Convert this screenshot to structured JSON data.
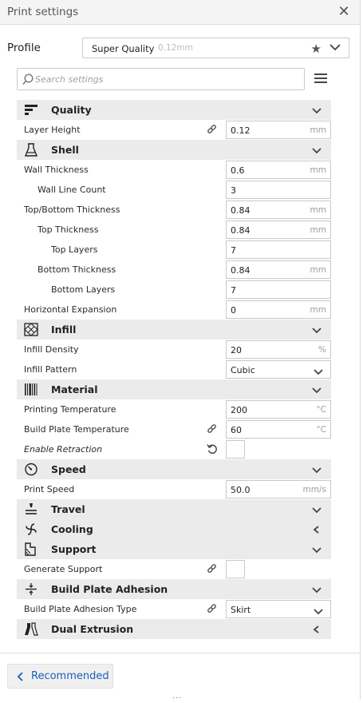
{
  "window": {
    "title": "Print settings",
    "close_icon": "close-icon"
  },
  "profile": {
    "label": "Profile",
    "selected": "Super Quality",
    "subtitle": "0.12mm"
  },
  "search": {
    "placeholder": "Search settings",
    "value": ""
  },
  "categories": {
    "quality": {
      "label": "Quality",
      "icon": "quality-icon",
      "expanded": true
    },
    "shell": {
      "label": "Shell",
      "icon": "shell-icon",
      "expanded": true
    },
    "infill": {
      "label": "Infill",
      "icon": "infill-icon",
      "expanded": true
    },
    "material": {
      "label": "Material",
      "icon": "material-icon",
      "expanded": true
    },
    "speed": {
      "label": "Speed",
      "icon": "speed-icon",
      "expanded": true
    },
    "travel": {
      "label": "Travel",
      "icon": "travel-icon",
      "expanded": true
    },
    "cooling": {
      "label": "Cooling",
      "icon": "cooling-icon",
      "expanded": false
    },
    "support": {
      "label": "Support",
      "icon": "support-icon",
      "expanded": true
    },
    "adhesion": {
      "label": "Build Plate Adhesion",
      "icon": "adhesion-icon",
      "expanded": true
    },
    "dual": {
      "label": "Dual Extrusion",
      "icon": "dual-extrusion-icon",
      "expanded": false
    }
  },
  "settings": {
    "layer_height": {
      "label": "Layer Height",
      "value": "0.12",
      "unit": "mm"
    },
    "wall_thickness": {
      "label": "Wall Thickness",
      "value": "0.6",
      "unit": "mm"
    },
    "wall_line_count": {
      "label": "Wall Line Count",
      "value": "3"
    },
    "top_bottom_thickness": {
      "label": "Top/Bottom Thickness",
      "value": "0.84",
      "unit": "mm"
    },
    "top_thickness": {
      "label": "Top Thickness",
      "value": "0.84",
      "unit": "mm"
    },
    "top_layers": {
      "label": "Top Layers",
      "value": "7"
    },
    "bottom_thickness": {
      "label": "Bottom Thickness",
      "value": "0.84",
      "unit": "mm"
    },
    "bottom_layers": {
      "label": "Bottom Layers",
      "value": "7"
    },
    "horizontal_expansion": {
      "label": "Horizontal Expansion",
      "value": "0",
      "unit": "mm"
    },
    "infill_density": {
      "label": "Infill Density",
      "value": "20",
      "unit": "%"
    },
    "infill_pattern": {
      "label": "Infill Pattern",
      "value": "Cubic"
    },
    "printing_temperature": {
      "label": "Printing Temperature",
      "value": "200",
      "unit": "°C"
    },
    "build_plate_temperature": {
      "label": "Build Plate Temperature",
      "value": "60",
      "unit": "°C"
    },
    "enable_retraction": {
      "label": "Enable Retraction",
      "checked": false
    },
    "print_speed": {
      "label": "Print Speed",
      "value": "50.0",
      "unit": "mm/s"
    },
    "generate_support": {
      "label": "Generate Support",
      "checked": false
    },
    "adhesion_type": {
      "label": "Build Plate Adhesion Type",
      "value": "Skirt"
    }
  },
  "footer": {
    "recommended_label": "Recommended",
    "grip": "···"
  },
  "colors": {
    "accent": "#1a5fb4",
    "category_bg": "#ebebeb",
    "border": "#c9c9c9"
  }
}
